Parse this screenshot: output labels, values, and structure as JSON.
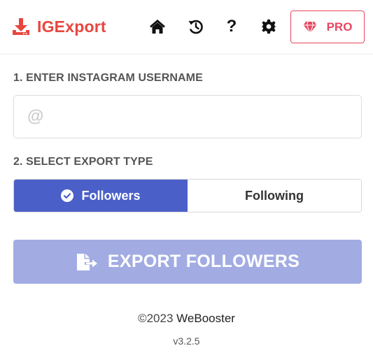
{
  "app": {
    "name": "IGExport",
    "brand_color": "#e8463f"
  },
  "header": {
    "nav_icons": [
      "home-icon",
      "history-icon",
      "help-icon",
      "settings-icon"
    ],
    "help_glyph": "?",
    "pro_button": {
      "label": "PRO",
      "icon": "diamond-icon",
      "color": "#e8465f"
    }
  },
  "step1": {
    "label": "1. ENTER INSTAGRAM USERNAME",
    "at_glyph": "@",
    "username_value": ""
  },
  "step2": {
    "label": "2. SELECT EXPORT TYPE",
    "options": [
      {
        "label": "Followers",
        "selected": true
      },
      {
        "label": "Following",
        "selected": false
      }
    ],
    "accent_color": "#4b5fc9"
  },
  "export_button": {
    "label": "EXPORT FOLLOWERS",
    "icon": "file-export-icon",
    "color": "#a2ace3"
  },
  "footer": {
    "copyright": "©2023",
    "company": "WeBooster",
    "version": "v3.2.5"
  }
}
